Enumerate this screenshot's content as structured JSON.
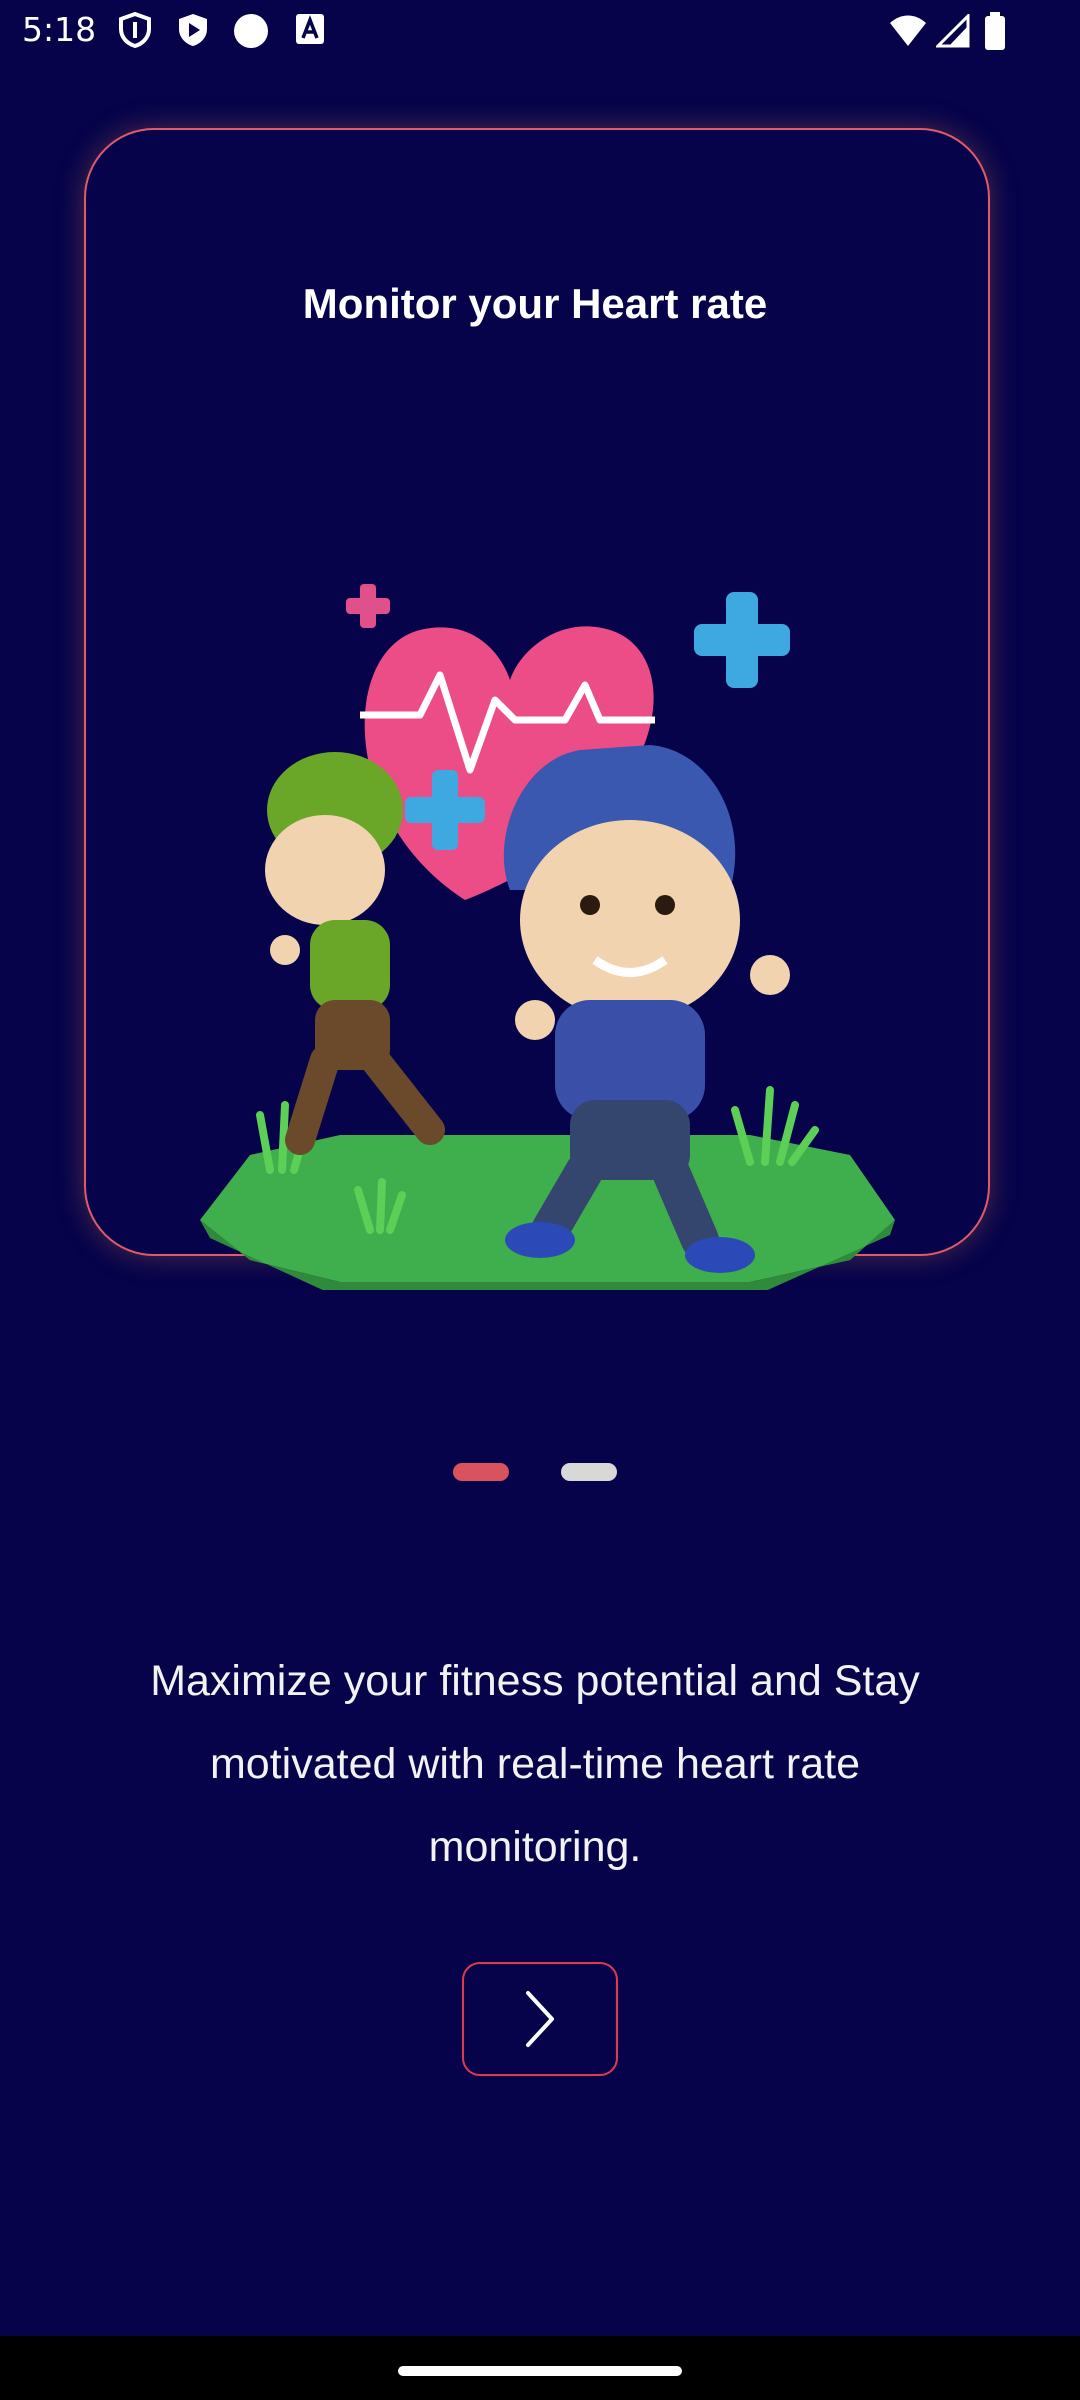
{
  "status_bar": {
    "time": "5:18",
    "left_icons": [
      "shield-icon",
      "play-protect-icon",
      "circle-icon",
      "font-icon"
    ],
    "right_icons": [
      "wifi-icon",
      "signal-icon",
      "battery-icon"
    ]
  },
  "card": {
    "title": "Monitor your Heart rate",
    "illustration": "heart-rate-runners-illustration",
    "border_color": "#e05a6a"
  },
  "pager": {
    "active_index": 0,
    "count": 2,
    "active_color": "#d9535f",
    "inactive_color": "#d8d8d8"
  },
  "description": "Maximize your fitness potential and Stay motivated with real-time heart rate monitoring.",
  "next_button": {
    "icon": "chevron-right-icon",
    "border_color": "#e03a4a"
  },
  "colors": {
    "background": "#06034b"
  }
}
